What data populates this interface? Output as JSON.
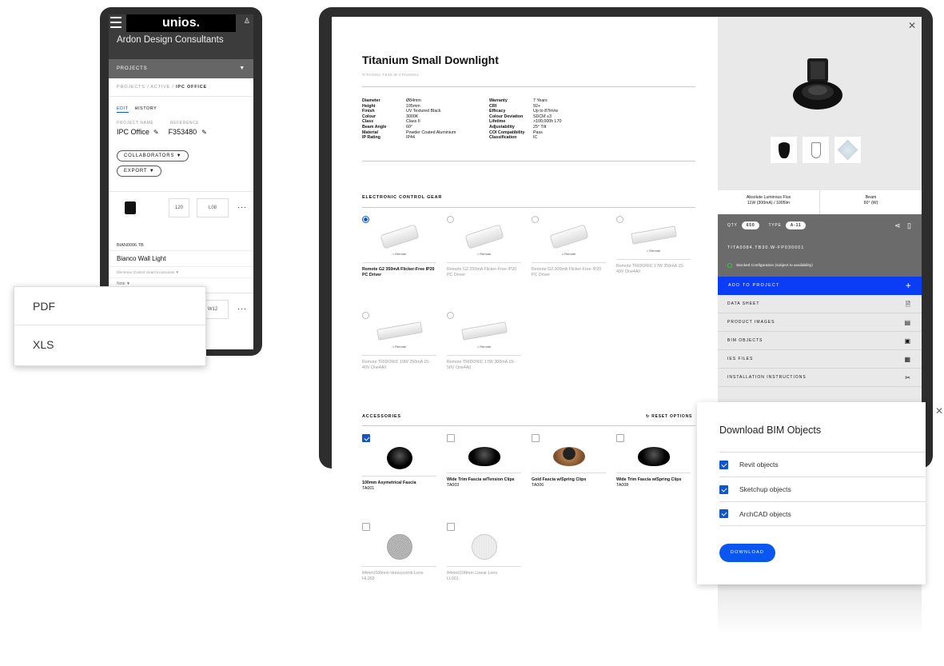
{
  "phone": {
    "logo": "unios.",
    "client": "Ardon Design Consultants",
    "projects_label": "PROJECTS",
    "crumb_prefix": "PROJECTS / ACTIVE / ",
    "crumb_current": "IPC OFFICE",
    "tabs": [
      "EDIT",
      "HISTORY"
    ],
    "project_name_label": "PROJECT NAME",
    "reference_label": "REFERENCE",
    "project_name": "IPC Office",
    "reference": "F353480",
    "collaborators": "COLLABORATORS",
    "export": "EXPORT",
    "item1": {
      "qty": "120",
      "ref": "L08",
      "sku": "BIAN0006.TB",
      "name": "Bianco Wall Light",
      "gear": "Electronic Control Gear/Accessories",
      "note": "Note"
    },
    "item2": {
      "qty": "880",
      "ref": "W12"
    }
  },
  "export_menu": [
    "PDF",
    "XLS"
  ],
  "product": {
    "title": "Titanium Small Downlight",
    "sku": "TITA0084.TB30.W-FP030001",
    "specs_left": [
      [
        "Diameter",
        "Ø84mm"
      ],
      [
        "Height",
        "105mm"
      ],
      [
        "Finish",
        "UV Textured Black"
      ],
      [
        "Colour",
        "3000K"
      ],
      [
        "Class",
        "Class II"
      ],
      [
        "Beam Angle",
        "60°"
      ],
      [
        "Material",
        "Powder Coated Aluminium"
      ],
      [
        "IP Rating",
        "IP44"
      ]
    ],
    "specs_right": [
      [
        "Warranty",
        "7 Years"
      ],
      [
        "CRI",
        "92+"
      ],
      [
        "Efficacy",
        "Up to 87lm/w"
      ],
      [
        "Colour Deviation",
        "SDCM ≤3"
      ],
      [
        "Lifetime",
        ">100,000h L70"
      ],
      [
        "Adjustability",
        "25° Tilt"
      ],
      [
        "COI Compatibility",
        "Pass"
      ],
      [
        "Classification",
        "IC"
      ]
    ]
  },
  "gear": {
    "title": "ELECTRONIC CONTROL GEAR",
    "remote_label": "Remote",
    "options": [
      {
        "name": "Remote G2 350mA Flicker-Free IP20 PC Driver",
        "selected": true
      },
      {
        "name": "Remote G2 250mA Flicker-Free IP20 PC Driver",
        "selected": false
      },
      {
        "name": "Remote G2 300mA Flicker-Free IP20 PC Driver",
        "selected": false
      },
      {
        "name": "Remote TRIDONIC 17W 350mA 15-49V One4All",
        "selected": false
      },
      {
        "name": "Remote TRIDONIC 10W 250mA 15-40V One4All",
        "selected": false
      },
      {
        "name": "Remote TRIDONIC 17W 300mA 15-50V One4All",
        "selected": false
      }
    ]
  },
  "accessories": {
    "title": "ACCESSORIES",
    "reset": "RESET OPTIONS",
    "items": [
      {
        "name": "100mm Asymetrical Fascia",
        "code": "TA001",
        "checked": true
      },
      {
        "name": "Wide Trim Fascia w/Tension Clips",
        "code": "TA003",
        "checked": false
      },
      {
        "name": "Gold Fascia w/Spring Clips",
        "code": "TA006",
        "checked": false
      },
      {
        "name": "Wide Trim Fascia w/Spring Clips",
        "code": "TA008",
        "checked": false
      },
      {
        "name": "84mm/100mm Honeycomb Lens",
        "code": "HL003",
        "checked": false
      },
      {
        "name": "84mm/100mm Linear Lens",
        "code": "LL001",
        "checked": false
      }
    ]
  },
  "side": {
    "flux_label": "Absolute Luminous Flux",
    "flux_value": "11W (300mA) / 1005lm",
    "beam_label": "Beam",
    "beam_value": "60° (W)",
    "qty_label": "QTY",
    "qty_value": "650",
    "type_label": "TYPE",
    "type_value": "A-11",
    "config_sku": "TITA0084.TB30.W-FP030001",
    "stock_note": "Stocked Configuration (subject to availability)",
    "add_to_project": "ADD TO PROJECT",
    "links": [
      "DATA SHEET",
      "PRODUCT IMAGES",
      "BIM OBJECTS",
      "IES FILES",
      "INSTALLATION INSTRUCTIONS"
    ]
  },
  "bim_modal": {
    "title": "Download BIM Objects",
    "options": [
      "Revit objects",
      "Sketchup objects",
      "ArchCAD objects"
    ],
    "download": "DOWNLOAD"
  },
  "colors": {
    "accent": "#0a3df5",
    "button": "#0a56f0",
    "dark_frame": "#2d2d2d"
  }
}
